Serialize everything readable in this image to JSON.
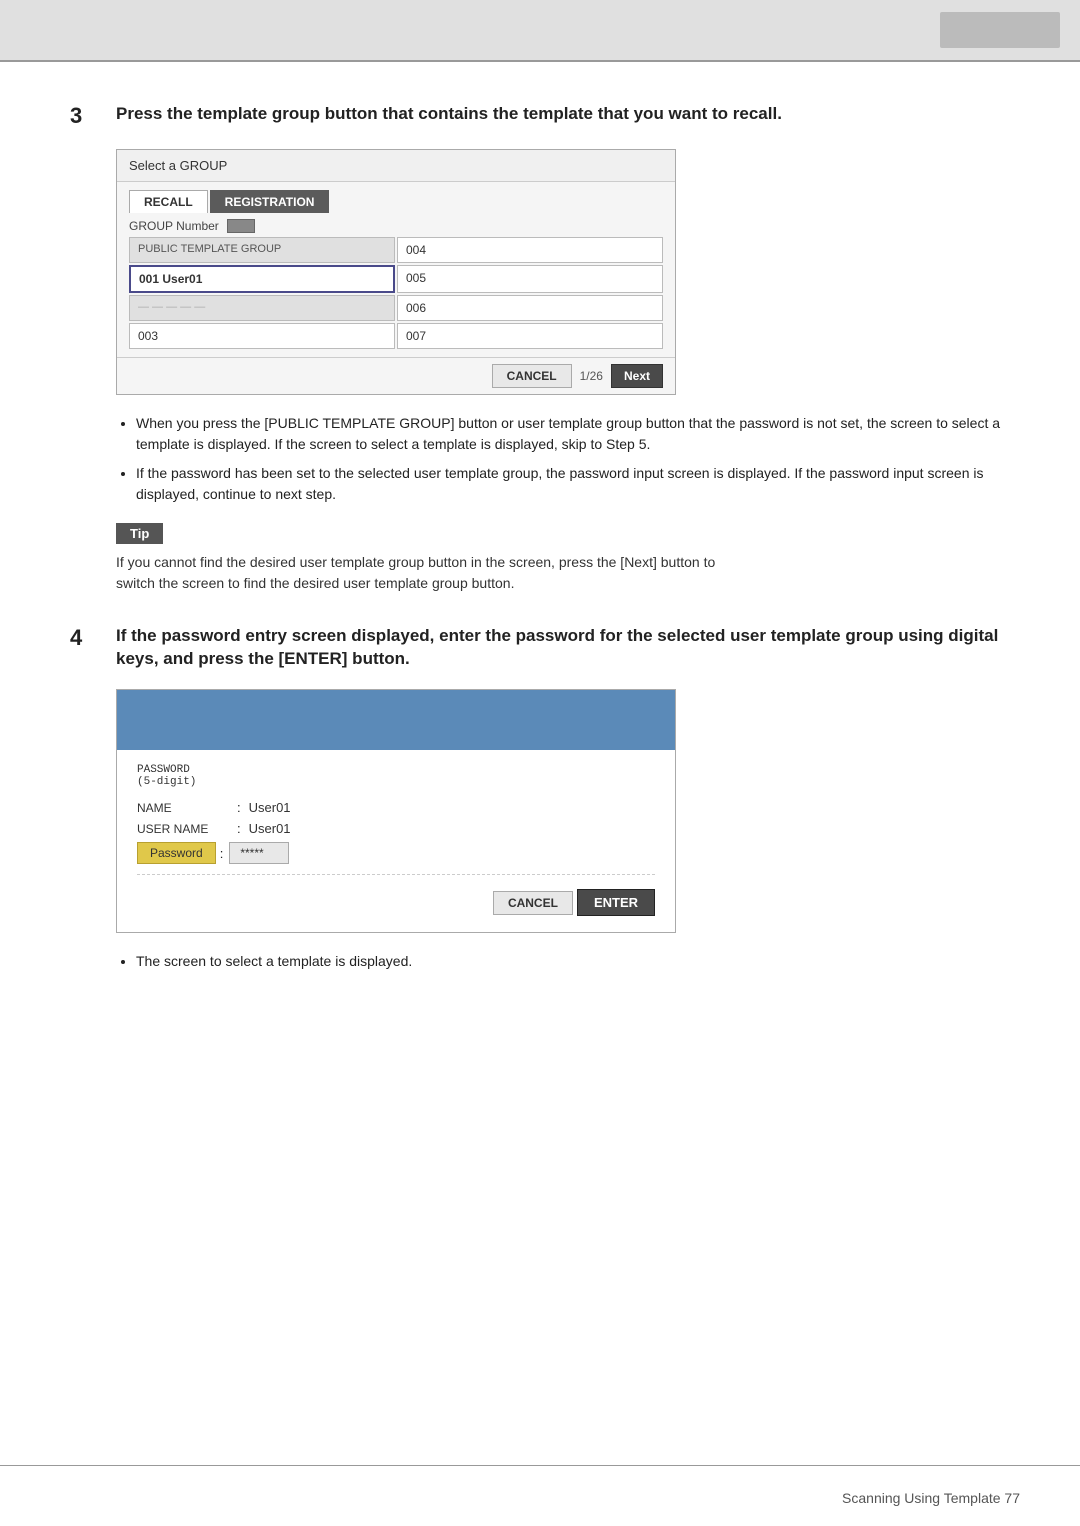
{
  "topBar": {
    "visible": true
  },
  "step3": {
    "number": "3",
    "title": "Press the template group button that contains the template that you want to recall.",
    "uiBox": {
      "header": "Select a GROUP",
      "tabRecall": "RECALL",
      "tabRegistration": "REGISTRATION",
      "groupNumberLabel": "GROUP Number",
      "cells": [
        {
          "id": "public",
          "label": "PUBLIC TEMPLATE GROUP",
          "type": "gray"
        },
        {
          "id": "004",
          "label": "004",
          "type": "normal"
        },
        {
          "id": "001",
          "label": "001 User01",
          "type": "selected"
        },
        {
          "id": "005",
          "label": "005",
          "type": "normal"
        },
        {
          "id": "002",
          "label": "",
          "type": "gray2"
        },
        {
          "id": "006",
          "label": "006",
          "type": "normal"
        },
        {
          "id": "003",
          "label": "003",
          "type": "normal"
        },
        {
          "id": "007",
          "label": "007",
          "type": "normal"
        }
      ],
      "cancelLabel": "CANCEL",
      "pageIndicator": "1/26",
      "nextLabel": "Next"
    },
    "bullets": [
      "When you press the [PUBLIC TEMPLATE GROUP] button or user template group button that the password is not set, the screen to select a template is displayed.  If the screen to select a template is displayed, skip to Step 5.",
      "If the password has been set to the selected user template group, the password input screen is displayed.  If the password input screen is displayed, continue to next step."
    ]
  },
  "tip": {
    "label": "Tip",
    "text": "If you cannot find the desired user template group button in the screen, press the [Next] button to switch the screen to find the desired user template group button."
  },
  "step4": {
    "number": "4",
    "title": "If the password entry screen displayed, enter the password for the selected user template group using digital keys, and press the [ENTER] button.",
    "uiBox": {
      "passwordLabel": "PASSWORD\n(5-digit)",
      "nameLabel": "NAME",
      "nameColon": ":",
      "nameValue": "User01",
      "userNameLabel": "USER NAME",
      "userNameColon": ":",
      "userNameValue": "User01",
      "passwordFieldLabel": "Password",
      "passwordFieldColon": ":",
      "passwordFieldValue": "*****",
      "cancelLabel": "CANCEL",
      "enterLabel": "ENTER"
    },
    "bullets": [
      "The screen to select a template is displayed."
    ]
  },
  "footer": {
    "text": "Scanning Using Template   77"
  }
}
